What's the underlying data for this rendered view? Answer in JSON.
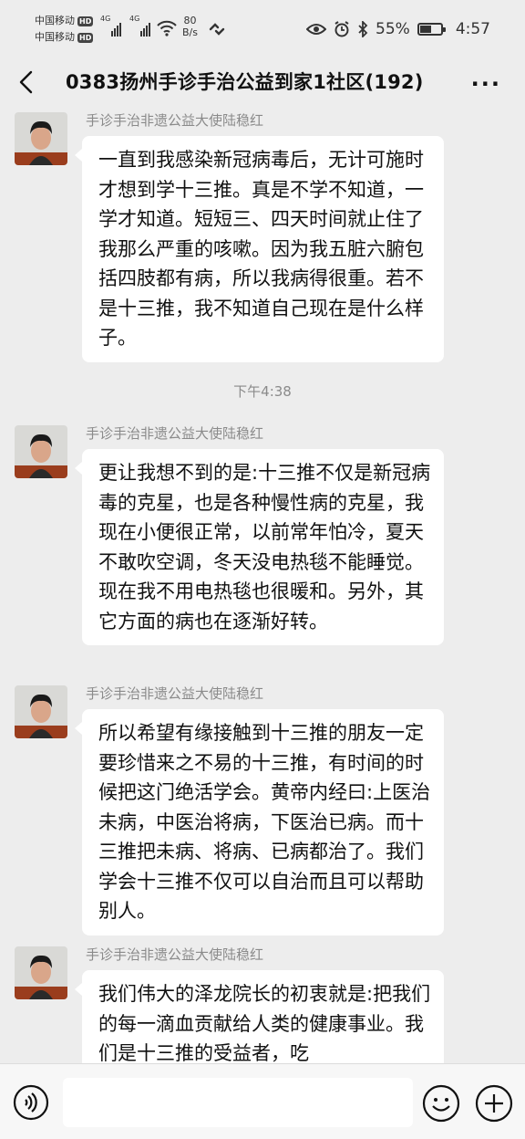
{
  "status": {
    "carrier1": "中国移动",
    "carrier2": "中国移动",
    "hd": "HD",
    "net1": "4G",
    "net2": "4G",
    "speed_value": "80",
    "speed_unit": "B/s",
    "battery": "55%",
    "battery_level": 0.55,
    "time": "4:57"
  },
  "header": {
    "title": "0383扬州手诊手治公益到家1社区(192)",
    "more": "···"
  },
  "messages": [
    {
      "sender": "手诊手治非遗公益大使陆稳红",
      "text": "一直到我感染新冠病毒后，无计可施时才想到学十三推。真是不学不知道，一学才知道。短短三、四天时间就止住了我那么严重的咳嗽。因为我五脏六腑包括四肢都有病，所以我病得很重。若不是十三推，我不知道自己现在是什么样子。"
    },
    {
      "sender": "手诊手治非遗公益大使陆稳红",
      "text": "更让我想不到的是:十三推不仅是新冠病毒的克星，也是各种慢性病的克星，我现在小便很正常，以前常年怕冷，夏天不敢吹空调，冬天没电热毯不能睡觉。现在我不用电热毯也很暖和。另外，其它方面的病也在逐渐好转。"
    },
    {
      "sender": "手诊手治非遗公益大使陆稳红",
      "text": "所以希望有缘接触到十三推的朋友一定要珍惜来之不易的十三推，有时间的时候把这门绝活学会。黄帝内经曰:上医治未病，中医治将病，下医治已病。而十三推把未病、将病、已病都治了。我们学会十三推不仅可以自治而且可以帮助别人。"
    },
    {
      "sender": "手诊手治非遗公益大使陆稳红",
      "text": "我们伟大的泽龙院长的初衷就是:把我们的每一滴血贡献给人类的健康事业。我们是十三推的受益者，吃"
    }
  ],
  "timestamp": "下午4:38"
}
